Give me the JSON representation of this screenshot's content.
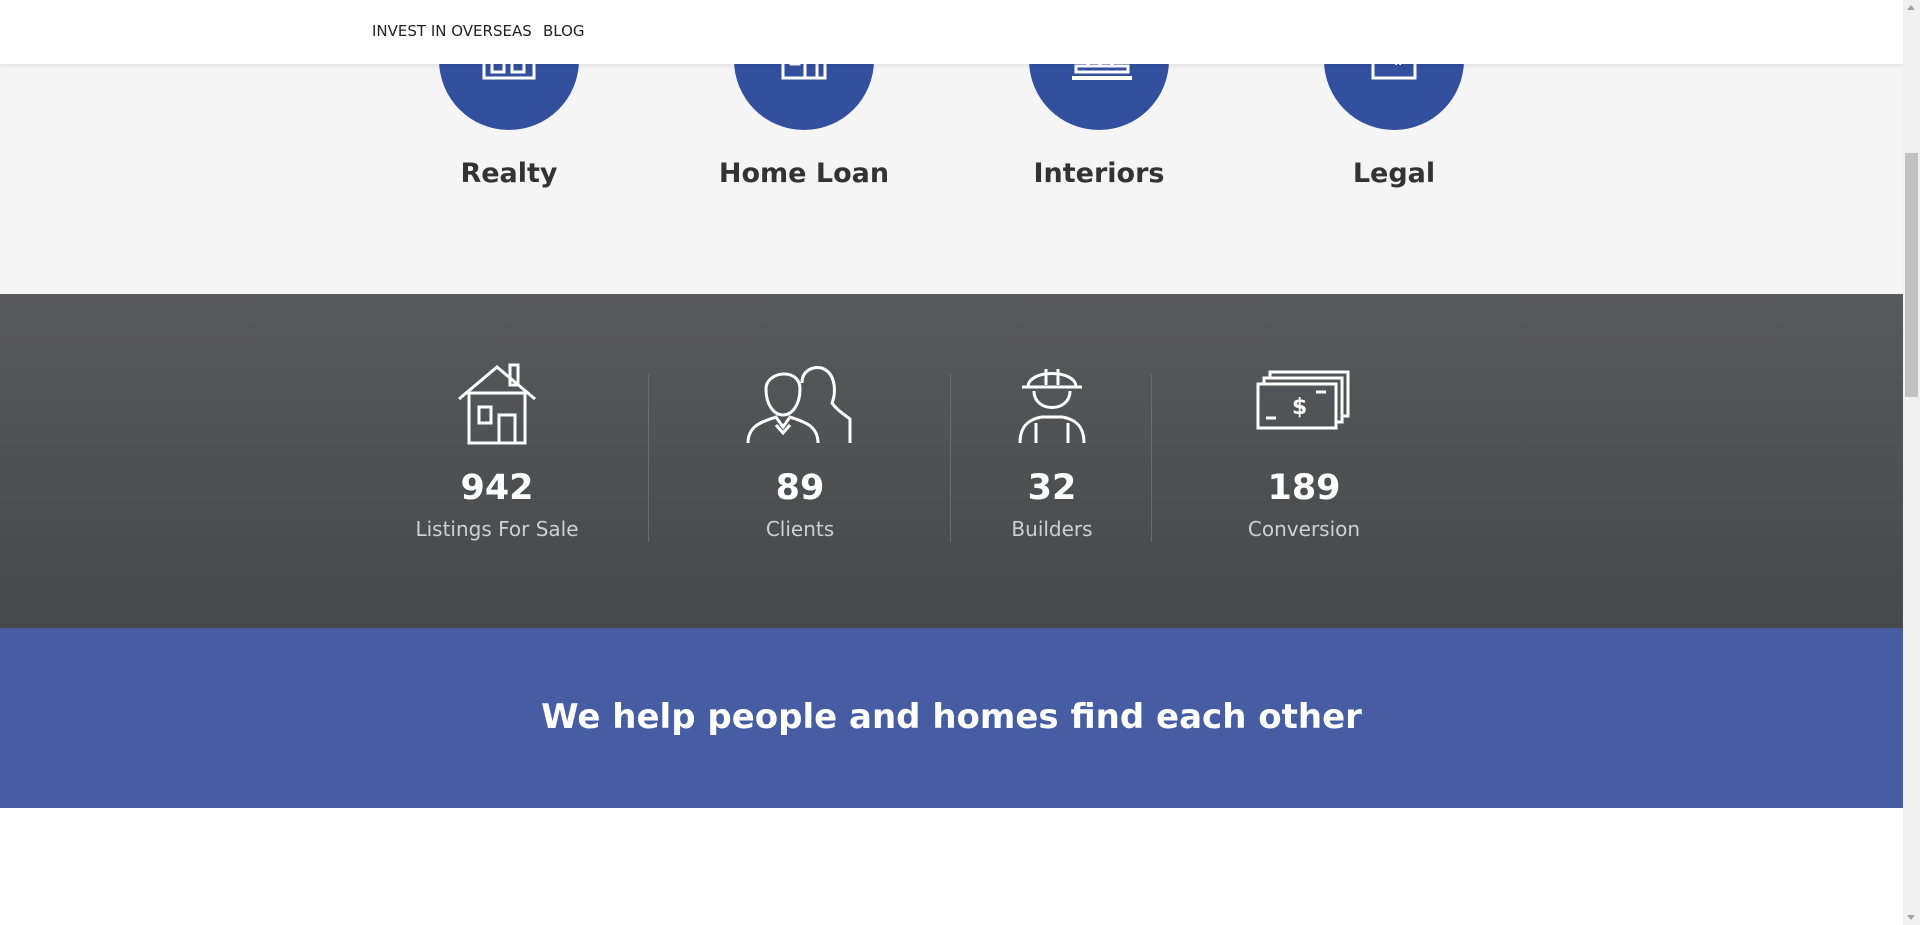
{
  "nav": {
    "items": [
      {
        "label": "INVEST IN OVERSEAS"
      },
      {
        "label": "BLOG"
      }
    ]
  },
  "services": [
    {
      "label": "Realty",
      "icon": "building-icon"
    },
    {
      "label": "Home Loan",
      "icon": "home-loan-icon"
    },
    {
      "label": "Interiors",
      "icon": "interiors-icon"
    },
    {
      "label": "Legal",
      "icon": "legal-document-icon"
    }
  ],
  "stats": [
    {
      "value": "942",
      "label": "Listings For Sale",
      "icon": "house-icon"
    },
    {
      "value": "89",
      "label": "Clients",
      "icon": "people-icon"
    },
    {
      "value": "32",
      "label": "Builders",
      "icon": "builder-hardhat-icon"
    },
    {
      "value": "189",
      "label": "Conversion",
      "icon": "money-stack-icon"
    }
  ],
  "banner": {
    "headline": "We help people and homes find each other"
  },
  "colors": {
    "brand_blue": "#33509f",
    "banner_blue": "#475da3",
    "stats_bg": "#505153"
  }
}
